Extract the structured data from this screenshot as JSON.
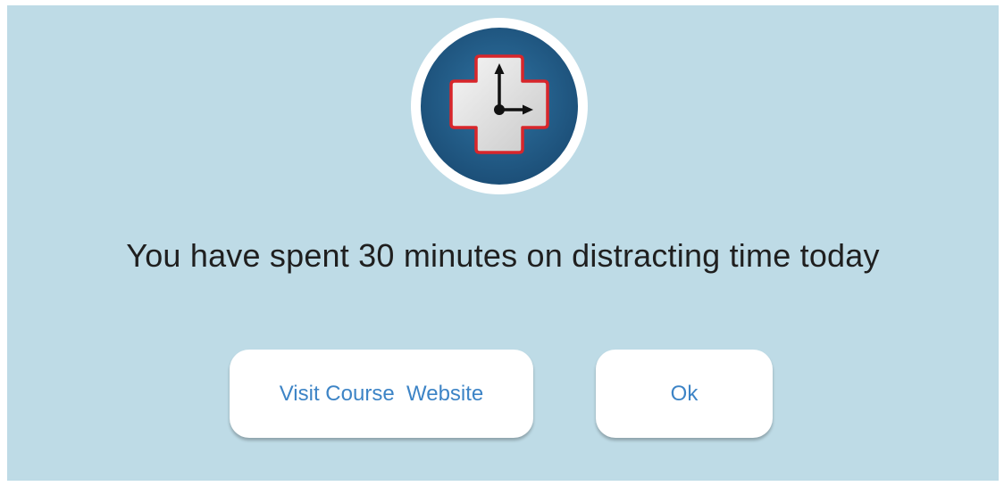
{
  "dialog": {
    "logo_icon": "clock-medical-cross-icon",
    "message": "You have spent 30 minutes on distracting time today",
    "buttons": {
      "visit_label": "Visit Course  Website",
      "ok_label": "Ok"
    }
  },
  "colors": {
    "background": "#bedbe6",
    "logo_circle": "#235d86",
    "cross_border": "#d8262b",
    "button_text": "#3d84c6"
  }
}
